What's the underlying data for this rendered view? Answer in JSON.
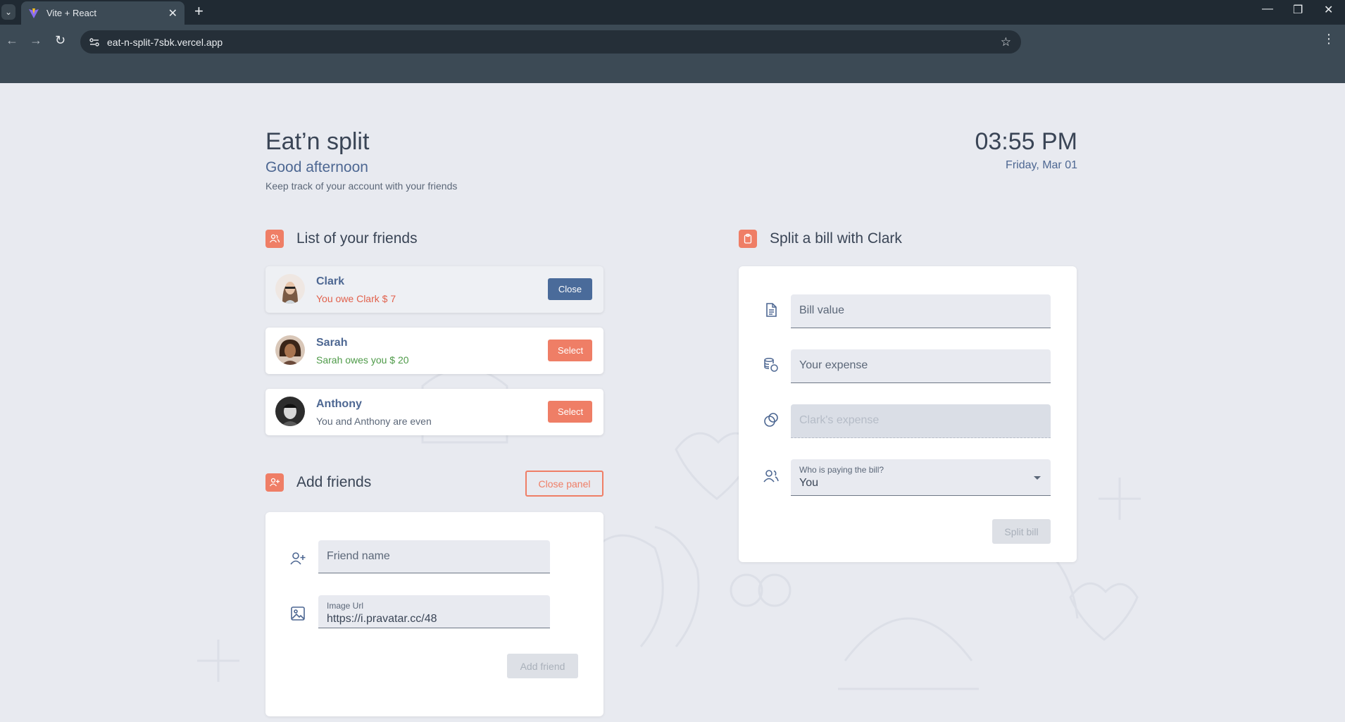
{
  "browser": {
    "tab_title": "Vite + React",
    "url": "eat-n-split-7sbk.vercel.app"
  },
  "header": {
    "title": "Eat’n split",
    "greeting": "Good afternoon",
    "subtitle": "Keep track of your account with your friends",
    "time": "03:55 PM",
    "date": "Friday, Mar 01"
  },
  "friends_section": {
    "title": "List of your friends",
    "friends": [
      {
        "name": "Clark",
        "status": "You owe Clark $ 7",
        "button": "Close",
        "selected": true
      },
      {
        "name": "Sarah",
        "status": "Sarah owes you $ 20",
        "button": "Select",
        "selected": false
      },
      {
        "name": "Anthony",
        "status": "You and Anthony are even",
        "button": "Select",
        "selected": false
      }
    ]
  },
  "add_friend": {
    "title": "Add friends",
    "close_panel": "Close panel",
    "name_placeholder": "Friend name",
    "image_label": "Image Url",
    "image_value": "https://i.pravatar.cc/48",
    "submit": "Add friend"
  },
  "split_bill": {
    "title": "Split a bill with Clark",
    "bill_placeholder": "Bill value",
    "expense_placeholder": "Your expense",
    "friend_expense_placeholder": "Clark's expense",
    "payer_label": "Who is paying the bill?",
    "payer_value": "You",
    "submit": "Split bill"
  },
  "colors": {
    "accent": "#ef7e66",
    "primary": "#4a6b9a",
    "owe": "#e1614c",
    "owed": "#4e9a48",
    "background": "#e8eaf0"
  },
  "icons": [
    "users-icon",
    "clipboard-icon",
    "user-plus-icon",
    "image-icon",
    "document-icon",
    "coins-icon",
    "circles-icon",
    "people-icon"
  ]
}
